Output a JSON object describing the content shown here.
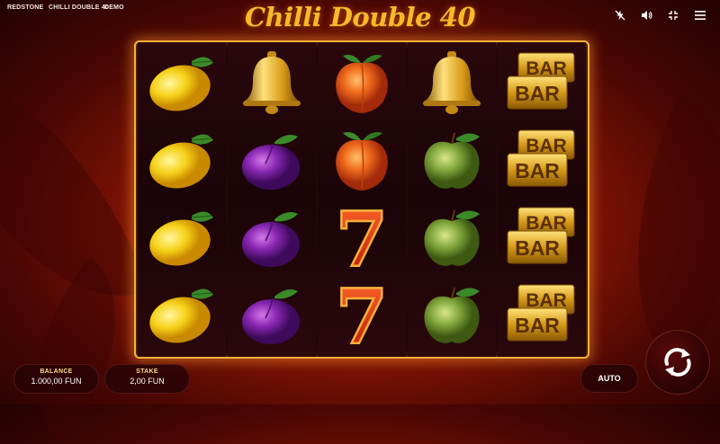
{
  "header": {
    "brand": "REDSTONE",
    "game_name": "CHILLI DOUBLE 40",
    "mode": "DEMO",
    "title": "Chilli Double 40"
  },
  "toolbar": {
    "icons": [
      "turbo-off-icon",
      "volume-icon",
      "fullscreen-icon",
      "menu-icon"
    ]
  },
  "reels": [
    [
      "lemon",
      "lemon",
      "lemon",
      "lemon"
    ],
    [
      "bell",
      "plum",
      "plum",
      "plum"
    ],
    [
      "peach",
      "peach",
      "seven",
      "seven"
    ],
    [
      "bell",
      "apple",
      "apple",
      "apple"
    ],
    [
      "bar",
      "bar",
      "bar",
      "bar"
    ]
  ],
  "symbol_text": {
    "bar": "BAR",
    "seven": "7"
  },
  "balance": {
    "label": "BALANCE",
    "value": "1.000,00 FUN"
  },
  "stake": {
    "label": "STAKE",
    "value": "2,00 FUN"
  },
  "auto_label": "AUTO",
  "colors": {
    "accent": "#f6b03a",
    "title": "#f8b92a",
    "background": "#8a1606"
  }
}
